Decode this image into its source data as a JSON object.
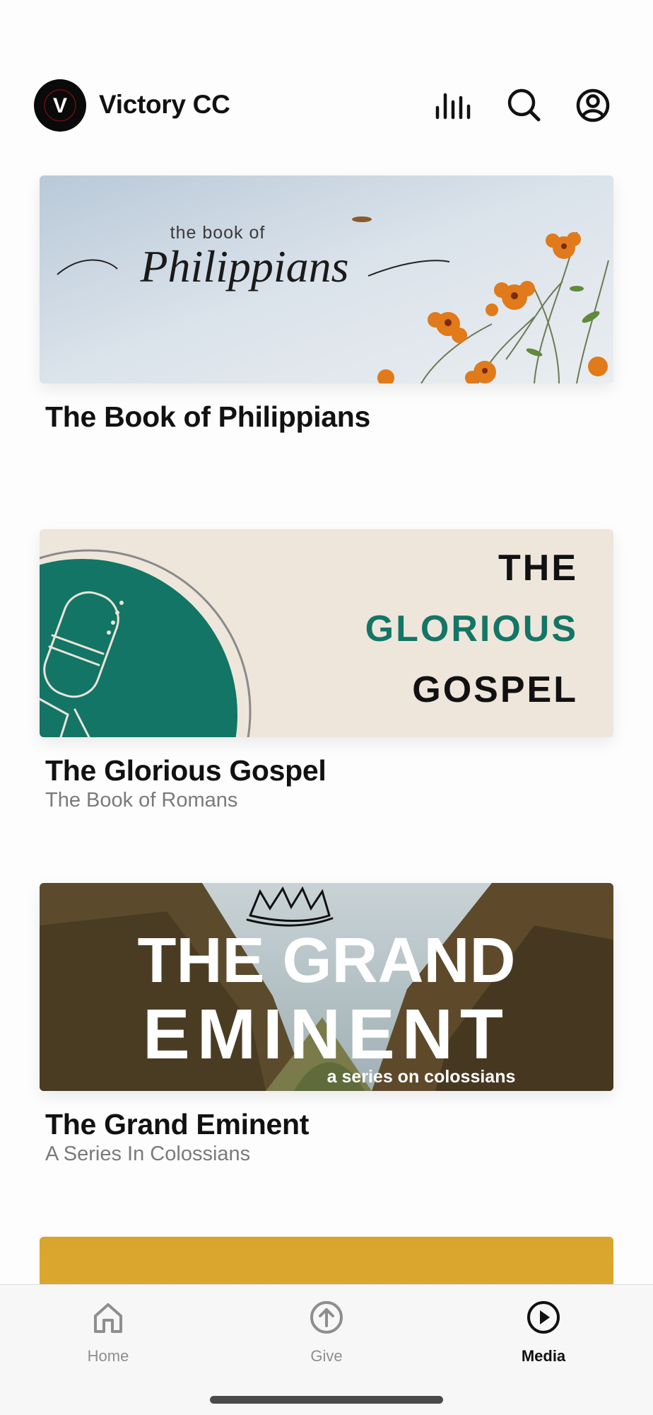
{
  "header": {
    "app_title": "Victory CC",
    "logo_letter": "V",
    "icons": [
      "equalizer-icon",
      "search-icon",
      "account-icon"
    ]
  },
  "series": [
    {
      "title": "The Book of Philippians",
      "subtitle": "",
      "banner": {
        "kicker": "the book of",
        "script_title": "Philippians"
      }
    },
    {
      "title": "The Glorious Gospel",
      "subtitle": "The Book of Romans",
      "banner": {
        "line1": "THE",
        "line2": "GLORIOUS",
        "line3": "GOSPEL",
        "accent": "#137565"
      }
    },
    {
      "title": "The Grand Eminent",
      "subtitle": "A Series In Colossians",
      "banner": {
        "line1": "THE GRAND",
        "line2": "EMINENT",
        "tagline": "a series on colossians"
      }
    }
  ],
  "tabbar": {
    "tabs": [
      {
        "label": "Home",
        "icon": "home-icon",
        "active": false
      },
      {
        "label": "Give",
        "icon": "give-icon",
        "active": false
      },
      {
        "label": "Media",
        "icon": "play-icon",
        "active": true
      }
    ]
  },
  "colors": {
    "partial_card": "#d9a52b",
    "teal": "#137565"
  }
}
